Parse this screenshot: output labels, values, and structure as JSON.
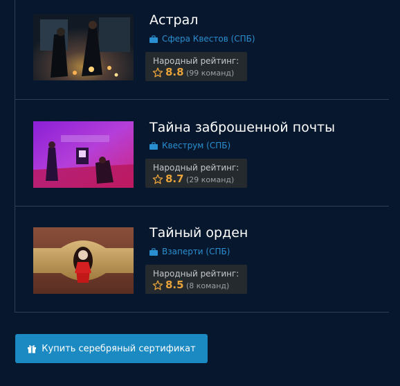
{
  "quests": [
    {
      "title": "Астрал",
      "company": "Сфера Квестов (СПБ)",
      "company_icon": "briefcase-icon",
      "rating_label": "Народный рейтинг:",
      "score": "8.8",
      "teams": "(99 команд)"
    },
    {
      "title": "Тайна заброшенной почты",
      "company": "Квеструм (СПБ)",
      "company_icon": "briefcase-icon",
      "rating_label": "Народный рейтинг:",
      "score": "8.7",
      "teams": "(29 команд)"
    },
    {
      "title": "Тайный орден",
      "company": "Взаперти (СПБ)",
      "company_icon": "briefcase-icon",
      "rating_label": "Народный рейтинг:",
      "score": "8.5",
      "teams": "(8 команд)"
    }
  ],
  "buy_button": {
    "label": "Купить серебряный сертификат",
    "icon": "gift-icon"
  },
  "colors": {
    "background": "#07182e",
    "link": "#2a8fd0",
    "score": "#e8a33a",
    "button": "#1c8ac2"
  }
}
